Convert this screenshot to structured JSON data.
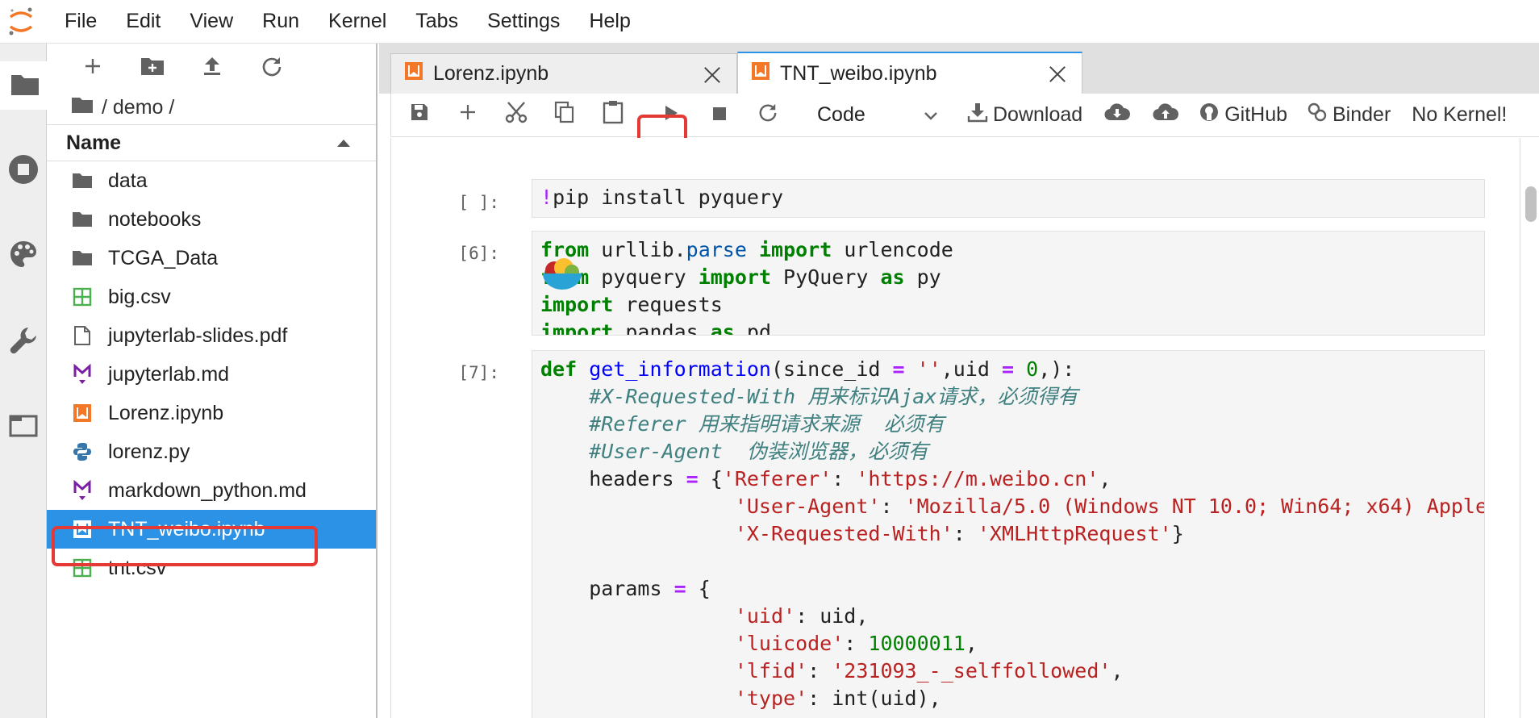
{
  "menubar": {
    "items": [
      "File",
      "Edit",
      "View",
      "Run",
      "Kernel",
      "Tabs",
      "Settings",
      "Help"
    ]
  },
  "filebrowser": {
    "breadcrumb": "/ demo /",
    "column_header": "Name",
    "files": [
      {
        "name": "data",
        "icon": "folder-icon"
      },
      {
        "name": "notebooks",
        "icon": "folder-icon"
      },
      {
        "name": "TCGA_Data",
        "icon": "folder-icon"
      },
      {
        "name": "big.csv",
        "icon": "spreadsheet-icon"
      },
      {
        "name": "jupyterlab-slides.pdf",
        "icon": "file-icon"
      },
      {
        "name": "jupyterlab.md",
        "icon": "markdown-icon"
      },
      {
        "name": "Lorenz.ipynb",
        "icon": "notebook-icon"
      },
      {
        "name": "lorenz.py",
        "icon": "python-icon"
      },
      {
        "name": "markdown_python.md",
        "icon": "markdown-icon"
      },
      {
        "name": "TNT_weibo.ipynb",
        "icon": "notebook-icon",
        "selected": true
      },
      {
        "name": "tnt.csv",
        "icon": "spreadsheet-icon"
      }
    ]
  },
  "tabs": [
    {
      "label": "Lorenz.ipynb",
      "active": false
    },
    {
      "label": "TNT_weibo.ipynb",
      "active": true
    }
  ],
  "toolbar": {
    "cell_type": "Code",
    "download_label": "Download",
    "github_label": "GitHub",
    "binder_label": "Binder",
    "kernel_status": "No Kernel!"
  },
  "cells": [
    {
      "prompt": "[ ]:"
    },
    {
      "prompt": "[6]:"
    },
    {
      "prompt": "[7]:"
    }
  ],
  "colors": {
    "accent": "#2c92e6",
    "highlight_box": "#e53935",
    "notebook_orange": "#f37726"
  }
}
